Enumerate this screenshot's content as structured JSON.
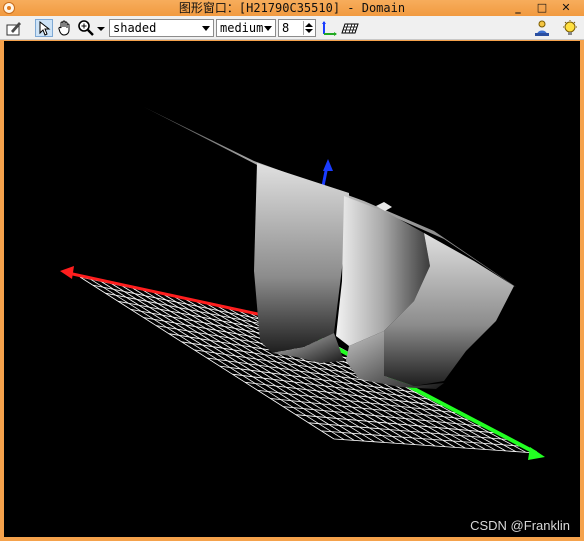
{
  "window": {
    "title": "图形窗口：[H21790C35510] - Domain",
    "controls": {
      "minimize": "_",
      "maximize": "□",
      "close": "✕"
    }
  },
  "toolbar": {
    "icons": [
      "edit-pencil-icon",
      "pointer-select-icon",
      "pan-hand-icon",
      "zoom-magnifier-icon",
      "axes-icon",
      "grid-plane-icon",
      "lighting-person-icon",
      "lightbulb-icon"
    ],
    "render_mode": {
      "selected": "shaded"
    },
    "quality": {
      "selected": "medium"
    },
    "level": {
      "value": "8"
    }
  },
  "viewport": {
    "background": "#000000",
    "axis_colors": {
      "x": "#ff1e1e",
      "y": "#22ff22",
      "z": "#1a3cff"
    }
  },
  "watermark": "CSDN @Franklin"
}
